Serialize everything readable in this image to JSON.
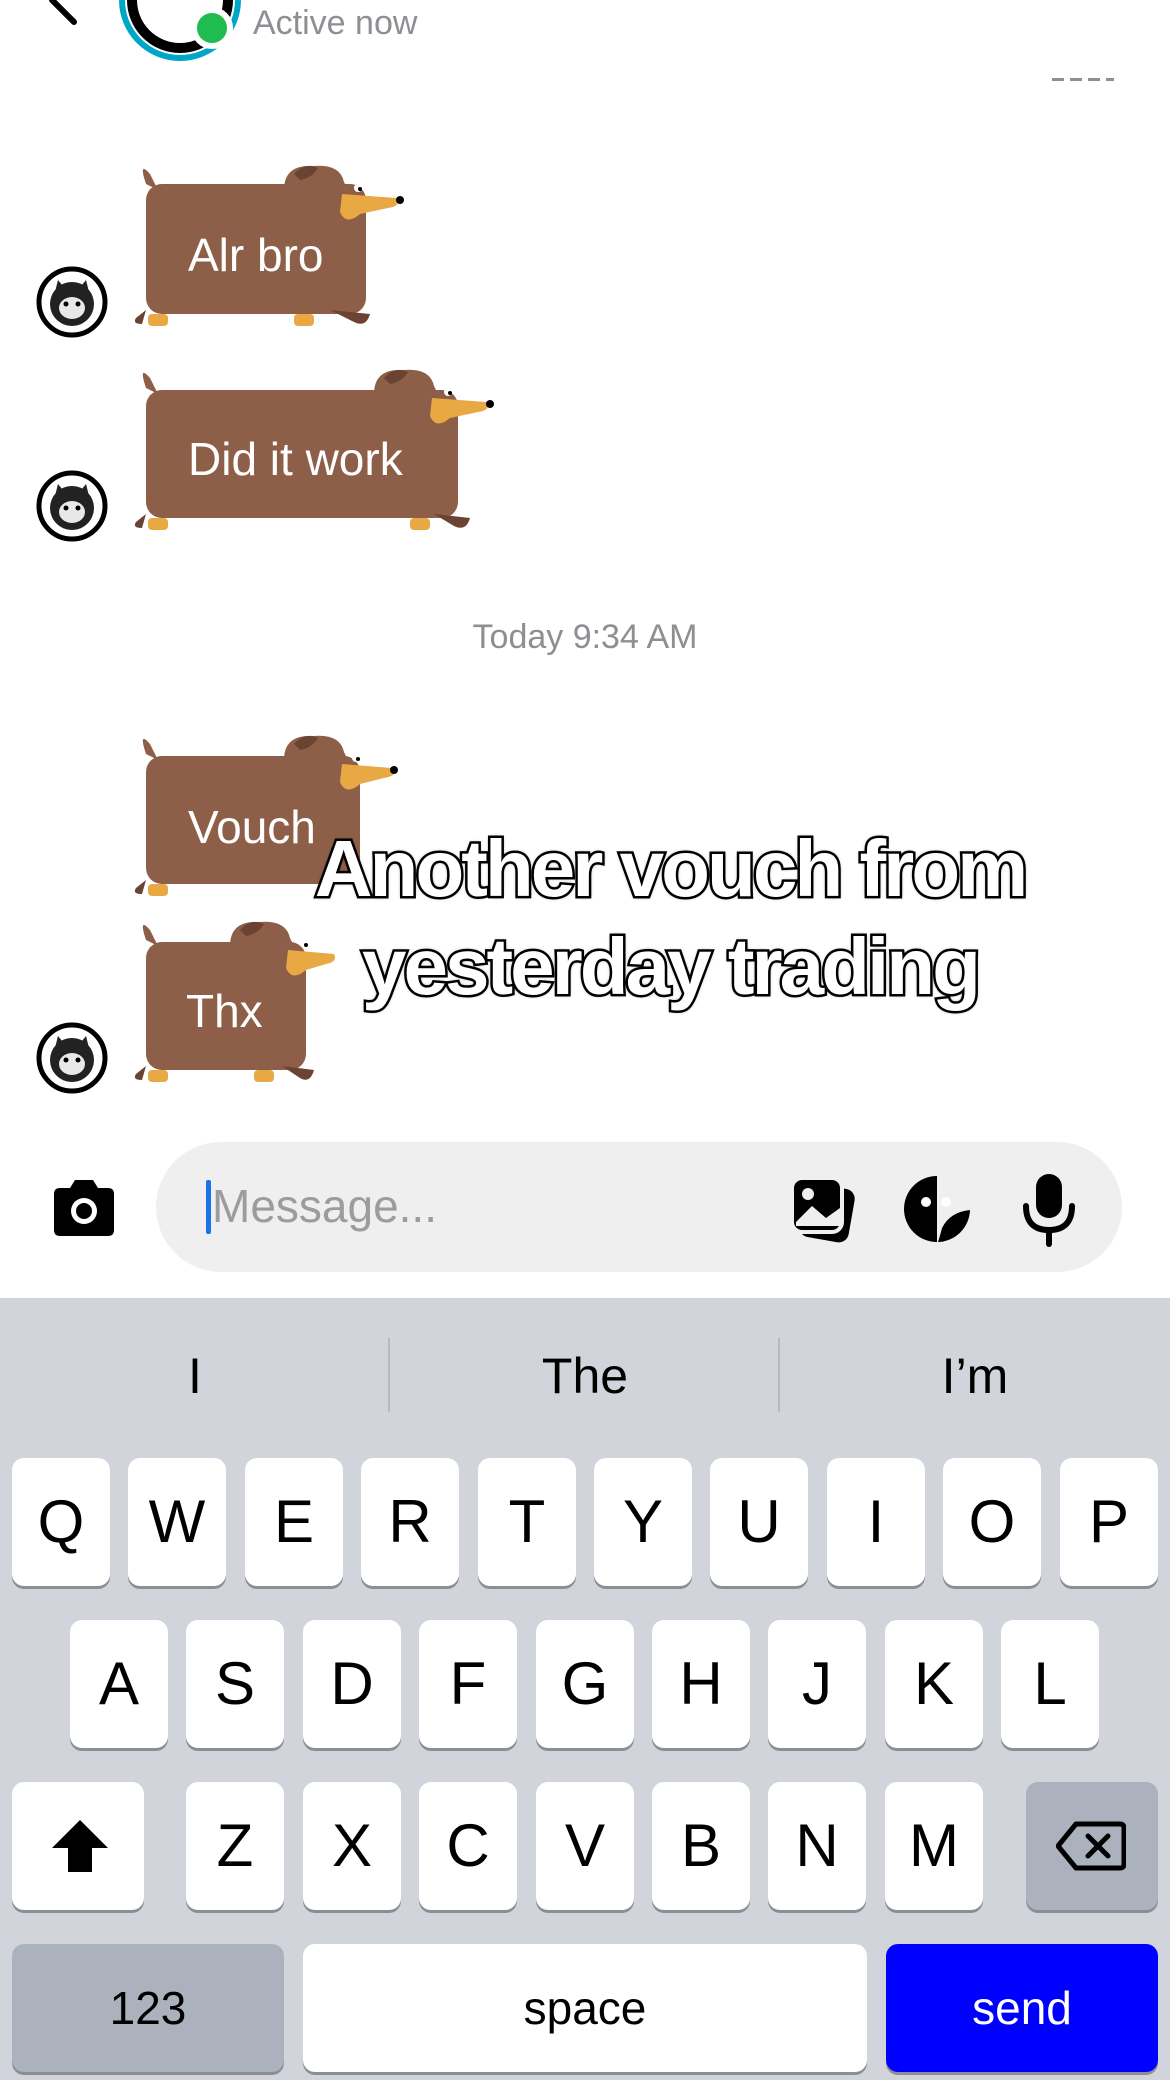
{
  "header": {
    "status": "Active now",
    "status_dot_color": "#1fbd4f",
    "back_icon": "chevron-left-icon",
    "more_icon": "more-horizontal-icon"
  },
  "messages": [
    {
      "sender": "other",
      "type": "sticker",
      "text": "Alr bro"
    },
    {
      "sender": "other",
      "type": "sticker",
      "text": "Did it work"
    },
    {
      "sender": "other",
      "type": "sticker",
      "text": "Vouch"
    },
    {
      "sender": "other",
      "type": "sticker",
      "text": "Thx"
    }
  ],
  "timestamp": "Today 9:34 AM",
  "overlay_caption": {
    "line1": "Another vouch from",
    "line2": "yesterday trading"
  },
  "composer": {
    "placeholder": "Message...",
    "value": "",
    "icons": [
      "camera-icon",
      "gallery-icon",
      "sticker-icon",
      "microphone-icon"
    ]
  },
  "keyboard": {
    "suggestions": [
      "I",
      "The",
      "I’m"
    ],
    "row1": [
      "Q",
      "W",
      "E",
      "R",
      "T",
      "Y",
      "U",
      "I",
      "O",
      "P"
    ],
    "row2": [
      "A",
      "S",
      "D",
      "F",
      "G",
      "H",
      "J",
      "K",
      "L"
    ],
    "row3": [
      "Z",
      "X",
      "C",
      "V",
      "B",
      "N",
      "M"
    ],
    "numbers_label": "123",
    "space_label": "space",
    "send_label": "send",
    "send_color": "#0000ff"
  },
  "colors": {
    "sticker_body": "#8e5f48",
    "sticker_accent": "#e8a844",
    "keyboard_bg": "#d1d4db"
  }
}
